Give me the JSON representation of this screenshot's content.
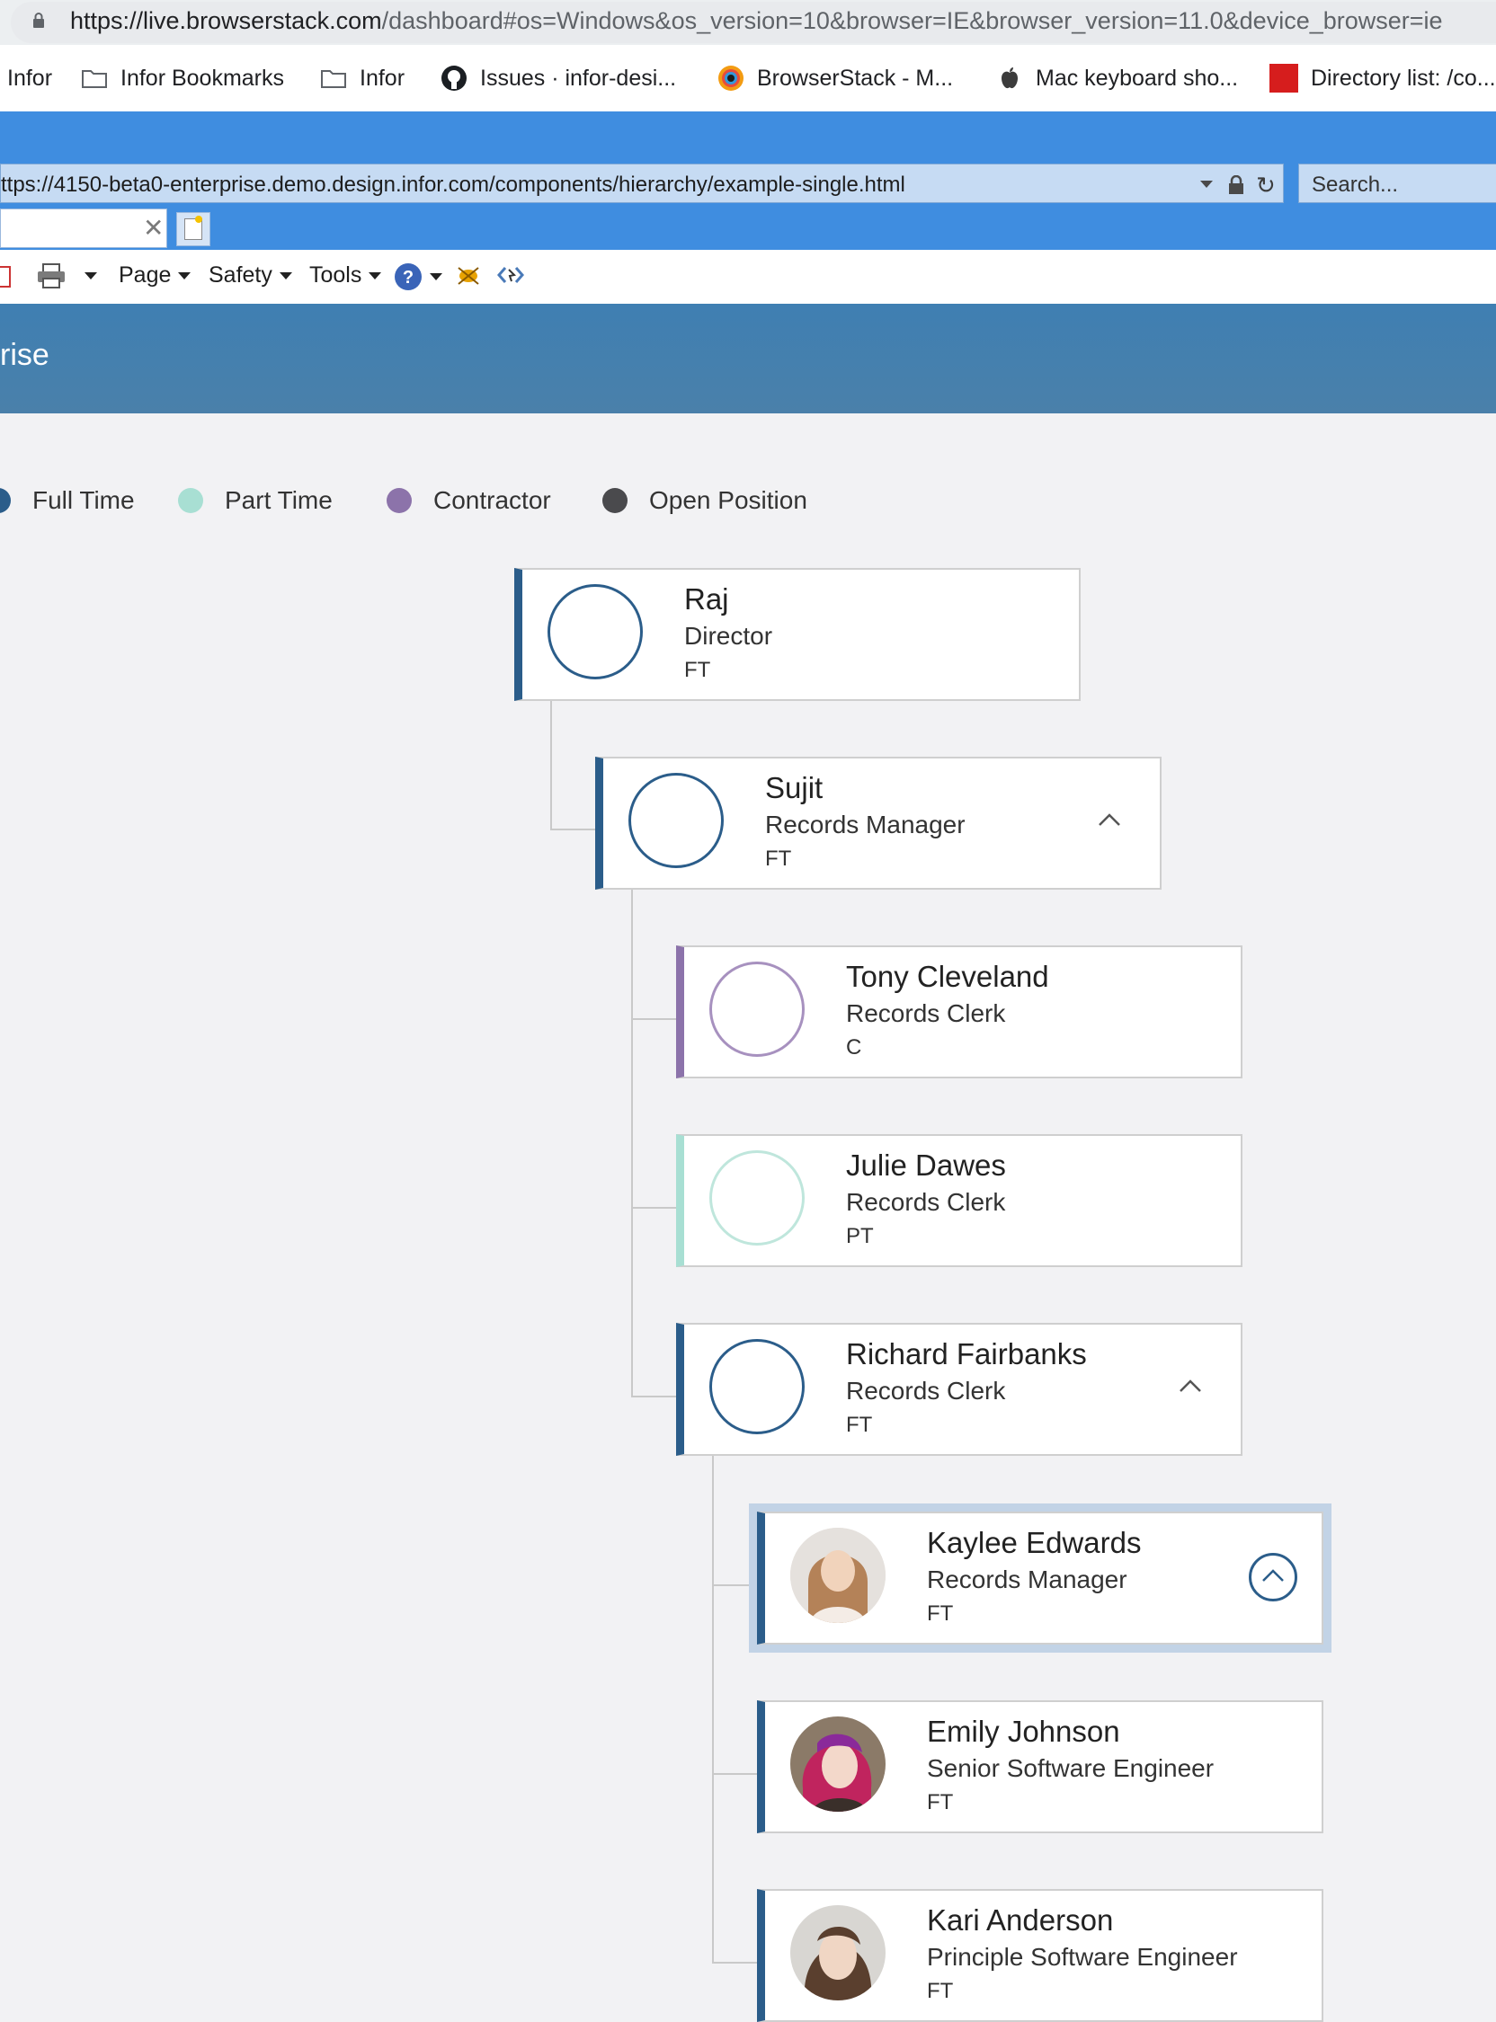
{
  "browser": {
    "url_host": "https://live.browserstack.com",
    "url_rest": "/dashboard#os=Windows&os_version=10&browser=IE&browser_version=11.0&device_browser=ie"
  },
  "bookmarks": [
    {
      "label": "Infor",
      "icon": "none"
    },
    {
      "label": "Infor Bookmarks",
      "icon": "folder-icon"
    },
    {
      "label": "Infor",
      "icon": "folder-icon"
    },
    {
      "label": "Issues · infor-desi...",
      "icon": "github-icon"
    },
    {
      "label": "BrowserStack - M...",
      "icon": "browserstack-icon"
    },
    {
      "label": "Mac keyboard sho...",
      "icon": "apple-icon"
    },
    {
      "label": "Directory list: /co...",
      "icon": "infor-logo-icon"
    }
  ],
  "ie": {
    "address": "ttps://4150-beta0-enterprise.demo.design.infor.com/components/hierarchy/example-single.html",
    "search_placeholder": "Search...",
    "commands": {
      "page": "Page",
      "safety": "Safety",
      "tools": "Tools"
    }
  },
  "app": {
    "title": "rise"
  },
  "legend": [
    {
      "label": "Full Time",
      "color": "#2b5d8a"
    },
    {
      "label": "Part Time",
      "color": "#a8dfd3"
    },
    {
      "label": "Contractor",
      "color": "#8c73aa"
    },
    {
      "label": "Open Position",
      "color": "#4a4a4d"
    }
  ],
  "colors": {
    "full_time": "#2b5d8a",
    "part_time": "#a8dfd3",
    "contractor": "#8c73aa"
  },
  "nodes": [
    {
      "name": "Raj",
      "title": "Director",
      "status": "FT"
    },
    {
      "name": "Sujit",
      "title": "Records Manager",
      "status": "FT"
    },
    {
      "name": "Tony Cleveland",
      "title": "Records Clerk",
      "status": "C"
    },
    {
      "name": "Julie Dawes",
      "title": "Records Clerk",
      "status": "PT"
    },
    {
      "name": "Richard Fairbanks",
      "title": "Records Clerk",
      "status": "FT"
    },
    {
      "name": "Kaylee Edwards",
      "title": "Records Manager",
      "status": "FT"
    },
    {
      "name": "Emily Johnson",
      "title": "Senior Software Engineer",
      "status": "FT"
    },
    {
      "name": "Kari Anderson",
      "title": "Principle Software Engineer",
      "status": "FT"
    }
  ]
}
